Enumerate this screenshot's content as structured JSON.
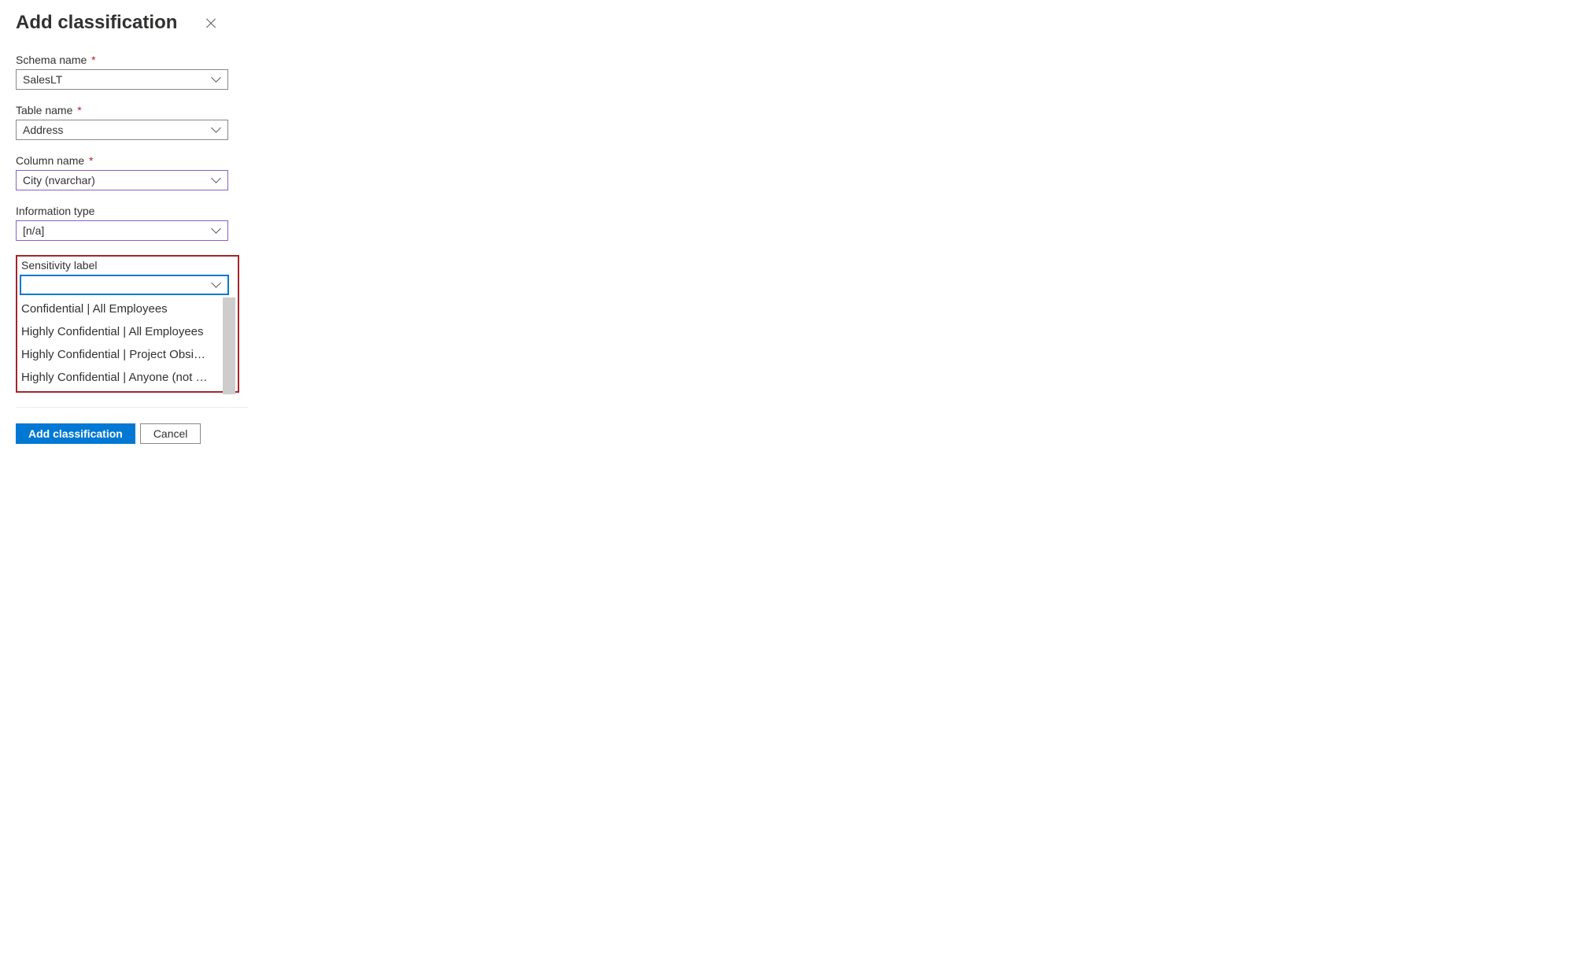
{
  "header": {
    "title": "Add classification"
  },
  "fields": {
    "schema": {
      "label": "Schema name",
      "required": true,
      "value": "SalesLT"
    },
    "table": {
      "label": "Table name",
      "required": true,
      "value": "Address"
    },
    "column": {
      "label": "Column name",
      "required": true,
      "value": "City (nvarchar)"
    },
    "infoType": {
      "label": "Information type",
      "required": false,
      "value": "[n/a]"
    },
    "sensitivity": {
      "label": "Sensitivity label",
      "required": false,
      "value": "",
      "options": [
        "Confidential | All Employees",
        "Highly Confidential | All Employees",
        "Highly Confidential | Project Obsidian",
        "Highly Confidential | Anyone (not prote…"
      ]
    }
  },
  "footer": {
    "primary": "Add classification",
    "secondary": "Cancel"
  }
}
